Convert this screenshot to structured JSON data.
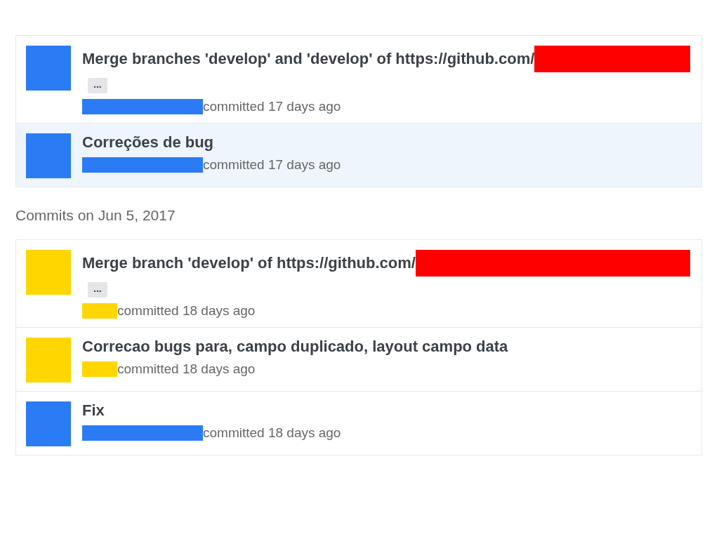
{
  "groups": [
    {
      "commits": [
        {
          "message": "Merge branches 'develop' and 'develop' of https://github.com/",
          "link_redacted": true,
          "expander": "...",
          "color": "#2b7bf5",
          "kind": "wide",
          "meta": "committed 17 days ago",
          "highlighted": false
        },
        {
          "message": "Correções de bug",
          "link_redacted": false,
          "color": "#2b7bf5",
          "kind": "wide",
          "meta": "committed 17 days ago",
          "highlighted": true
        }
      ]
    },
    {
      "heading": "Commits on Jun 5, 2017",
      "commits": [
        {
          "message": "Merge branch 'develop' of https://github.com/",
          "link_redacted": true,
          "expander": "...",
          "color": "#ffd600",
          "kind": "narrow",
          "meta": "committed 18 days ago",
          "highlighted": false
        },
        {
          "message": "Correcao bugs para, campo duplicado, layout campo data",
          "link_redacted": false,
          "color": "#ffd600",
          "kind": "narrow",
          "meta": "committed 18 days ago",
          "highlighted": false
        },
        {
          "message": "Fix",
          "link_redacted": false,
          "color": "#2b7bf5",
          "kind": "wide",
          "meta": "committed 18 days ago",
          "highlighted": false
        }
      ]
    }
  ]
}
